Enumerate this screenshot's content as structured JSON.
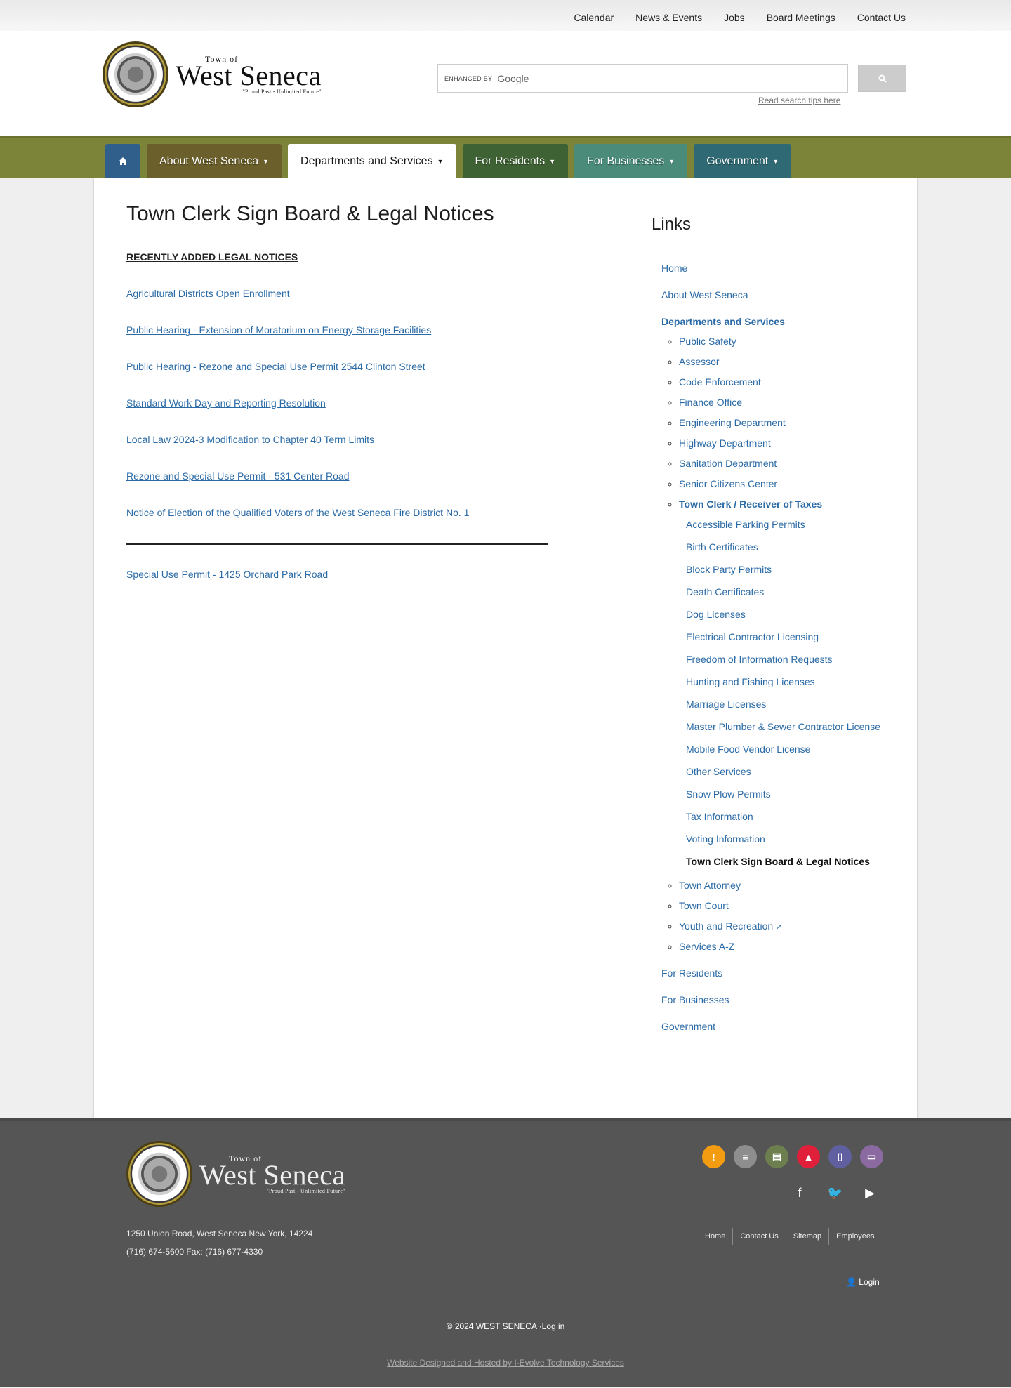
{
  "utility_nav": [
    "Calendar",
    "News & Events",
    "Jobs",
    "Board Meetings",
    "Contact Us"
  ],
  "logo": {
    "town_of": "Town of",
    "name": "West Seneca",
    "tagline": "\"Proud Past - Unlimited Future\""
  },
  "search": {
    "enhanced_by": "ENHANCED BY",
    "google": "Google",
    "button_icon": "search-icon",
    "tips_link": "Read search tips here"
  },
  "main_nav": {
    "home_icon": "home-icon",
    "tabs": [
      {
        "label": "About West Seneca",
        "color": "#6b5f2b"
      },
      {
        "label": "Departments and Services",
        "color": "#ffffff",
        "active": true
      },
      {
        "label": "For Residents",
        "color": "#3f6234"
      },
      {
        "label": "For Businesses",
        "color": "#4a8b7a"
      },
      {
        "label": "Government",
        "color": "#2f6a74"
      }
    ],
    "bar_color": "#7c843a"
  },
  "content": {
    "title": "Town Clerk Sign Board & Legal Notices",
    "section_heading": "RECENTLY ADDED LEGAL NOTICES",
    "notices": [
      "Agricultural Districts Open Enrollment",
      "Public Hearing - Extension of Moratorium on Energy Storage Facilities",
      "Public Hearing - Rezone and Special Use Permit 2544 Clinton Street",
      "Standard Work Day and Reporting Resolution",
      "Local Law 2024-3 Modification to Chapter 40 Term Limits",
      "Rezone and Special Use Permit - 531 Center Road",
      "Notice of Election of the Qualified Voters of the West Seneca Fire District No. 1"
    ],
    "older_notices": [
      "Special Use Permit - 1425 Orchard Park Road"
    ]
  },
  "sidebar": {
    "title": "Links",
    "top": [
      "Home",
      "About West Seneca"
    ],
    "departments_label": "Departments and Services",
    "departments": [
      "Public Safety",
      "Assessor",
      "Code Enforcement",
      "Finance Office",
      "Engineering Department",
      "Highway Department",
      "Sanitation Department",
      "Senior Citizens Center"
    ],
    "town_clerk_label": "Town Clerk / Receiver of Taxes",
    "town_clerk_items": [
      "Accessible Parking Permits",
      "Birth Certificates",
      "Block Party Permits",
      "Death Certificates",
      "Dog Licenses",
      "Electrical Contractor Licensing",
      "Freedom of Information Requests",
      "Hunting and Fishing Licenses",
      "Marriage Licenses",
      "Master Plumber & Sewer Contractor License",
      "Mobile Food Vendor License",
      "Other Services",
      "Snow Plow Permits",
      "Tax Information",
      "Voting Information"
    ],
    "current_page": "Town Clerk Sign Board & Legal Notices",
    "departments_after": [
      "Town Attorney",
      "Town Court",
      "Youth and Recreation",
      "Services A-Z"
    ],
    "bottom": [
      "For Residents",
      "For Businesses",
      "Government"
    ]
  },
  "footer": {
    "address": "1250 Union Road, West Seneca New York, 14224",
    "phone": "(716) 674-5600 Fax: (716) 677-4330",
    "quick_icons": [
      {
        "name": "alert-icon",
        "glyph": "!",
        "color": "#f39c12"
      },
      {
        "name": "forms-icon",
        "glyph": "≡",
        "color": "#8e8e8e"
      },
      {
        "name": "directory-icon",
        "glyph": "▤",
        "color": "#6d7f4e"
      },
      {
        "name": "emergency-icon",
        "glyph": "▲",
        "color": "#e0203a"
      },
      {
        "name": "book-icon",
        "glyph": "▯",
        "color": "#6060a0"
      },
      {
        "name": "calendar-icon",
        "glyph": "▭",
        "color": "#8a6aa0"
      }
    ],
    "social": [
      {
        "name": "facebook-icon",
        "glyph": "f"
      },
      {
        "name": "twitter-icon",
        "glyph": "🐦"
      },
      {
        "name": "youtube-icon",
        "glyph": "▶"
      }
    ],
    "links": [
      "Home",
      "Contact Us",
      "Sitemap",
      "Employees"
    ],
    "login": "Login",
    "copyright": "© 2024 WEST SENECA ·Log in",
    "credit": "Website Designed and Hosted by I-Evolve Technology Services"
  }
}
